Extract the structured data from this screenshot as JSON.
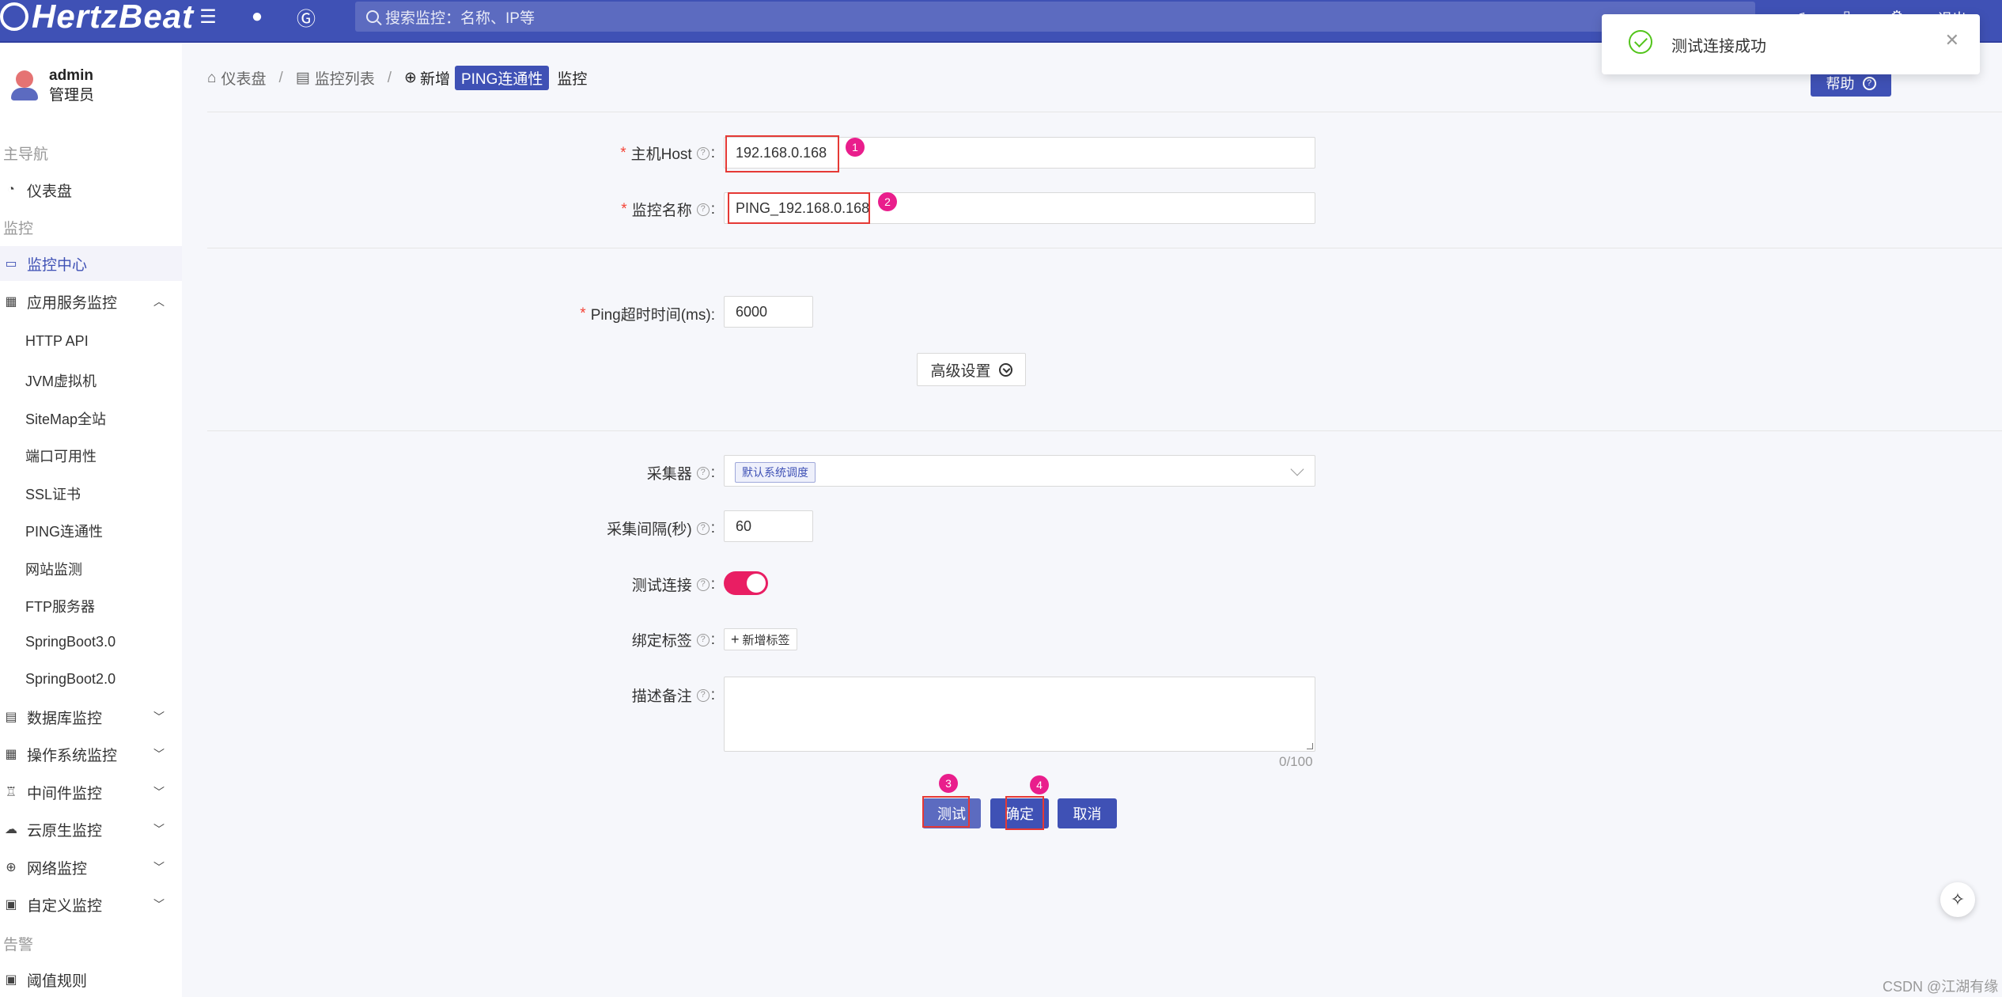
{
  "header": {
    "logo_text": "HertzBeat",
    "search_placeholder": "搜索监控：名称、IP等",
    "logout_label": "退出"
  },
  "user": {
    "name": "admin",
    "role": "管理员"
  },
  "sidebar": {
    "group_main": "主导航",
    "dashboard": "仪表盘",
    "group_monitor": "监控",
    "monitor_center": "监控中心",
    "app_monitor": "应用服务监控",
    "app_items": [
      "HTTP API",
      "JVM虚拟机",
      "SiteMap全站",
      "端口可用性",
      "SSL证书",
      "PING连通性",
      "网站监测",
      "FTP服务器",
      "SpringBoot3.0",
      "SpringBoot2.0"
    ],
    "db_monitor": "数据库监控",
    "os_monitor": "操作系统监控",
    "middleware_monitor": "中间件监控",
    "cloud_native_monitor": "云原生监控",
    "network_monitor": "网络监控",
    "custom_monitor": "自定义监控",
    "group_alert": "告警",
    "threshold_rules": "阈值规则"
  },
  "breadcrumb": {
    "dashboard": "仪表盘",
    "monitor_list": "监控列表",
    "new_label": "新增",
    "type_tag": "PING连通性",
    "monitor": "监控"
  },
  "help_button": "帮助",
  "form": {
    "host_label": "主机Host",
    "host_value": "192.168.0.168",
    "name_label": "监控名称",
    "name_value": "PING_192.168.0.168",
    "timeout_label": "Ping超时时间(ms):",
    "timeout_value": "6000",
    "advanced_button": "高级设置",
    "collector_label": "采集器",
    "collector_value": "默认系统调度",
    "interval_label": "采集间隔(秒)",
    "interval_value": "60",
    "test_conn_label": "测试连接",
    "test_conn_enabled": true,
    "bind_tags_label": "绑定标签",
    "add_tag_button": "新增标签",
    "desc_label": "描述备注",
    "desc_value": "",
    "desc_counter": "0/100"
  },
  "buttons": {
    "test": "测试",
    "confirm": "确定",
    "cancel": "取消"
  },
  "annotations": [
    "1",
    "2",
    "3",
    "4"
  ],
  "toast": {
    "message": "测试连接成功"
  },
  "watermark": "CSDN @江湖有缘",
  "colors": {
    "primary": "#3f51b5",
    "danger": "#e53935",
    "toggle": "#e91e63",
    "marker": "#e91e8c",
    "success": "#52c41a"
  }
}
